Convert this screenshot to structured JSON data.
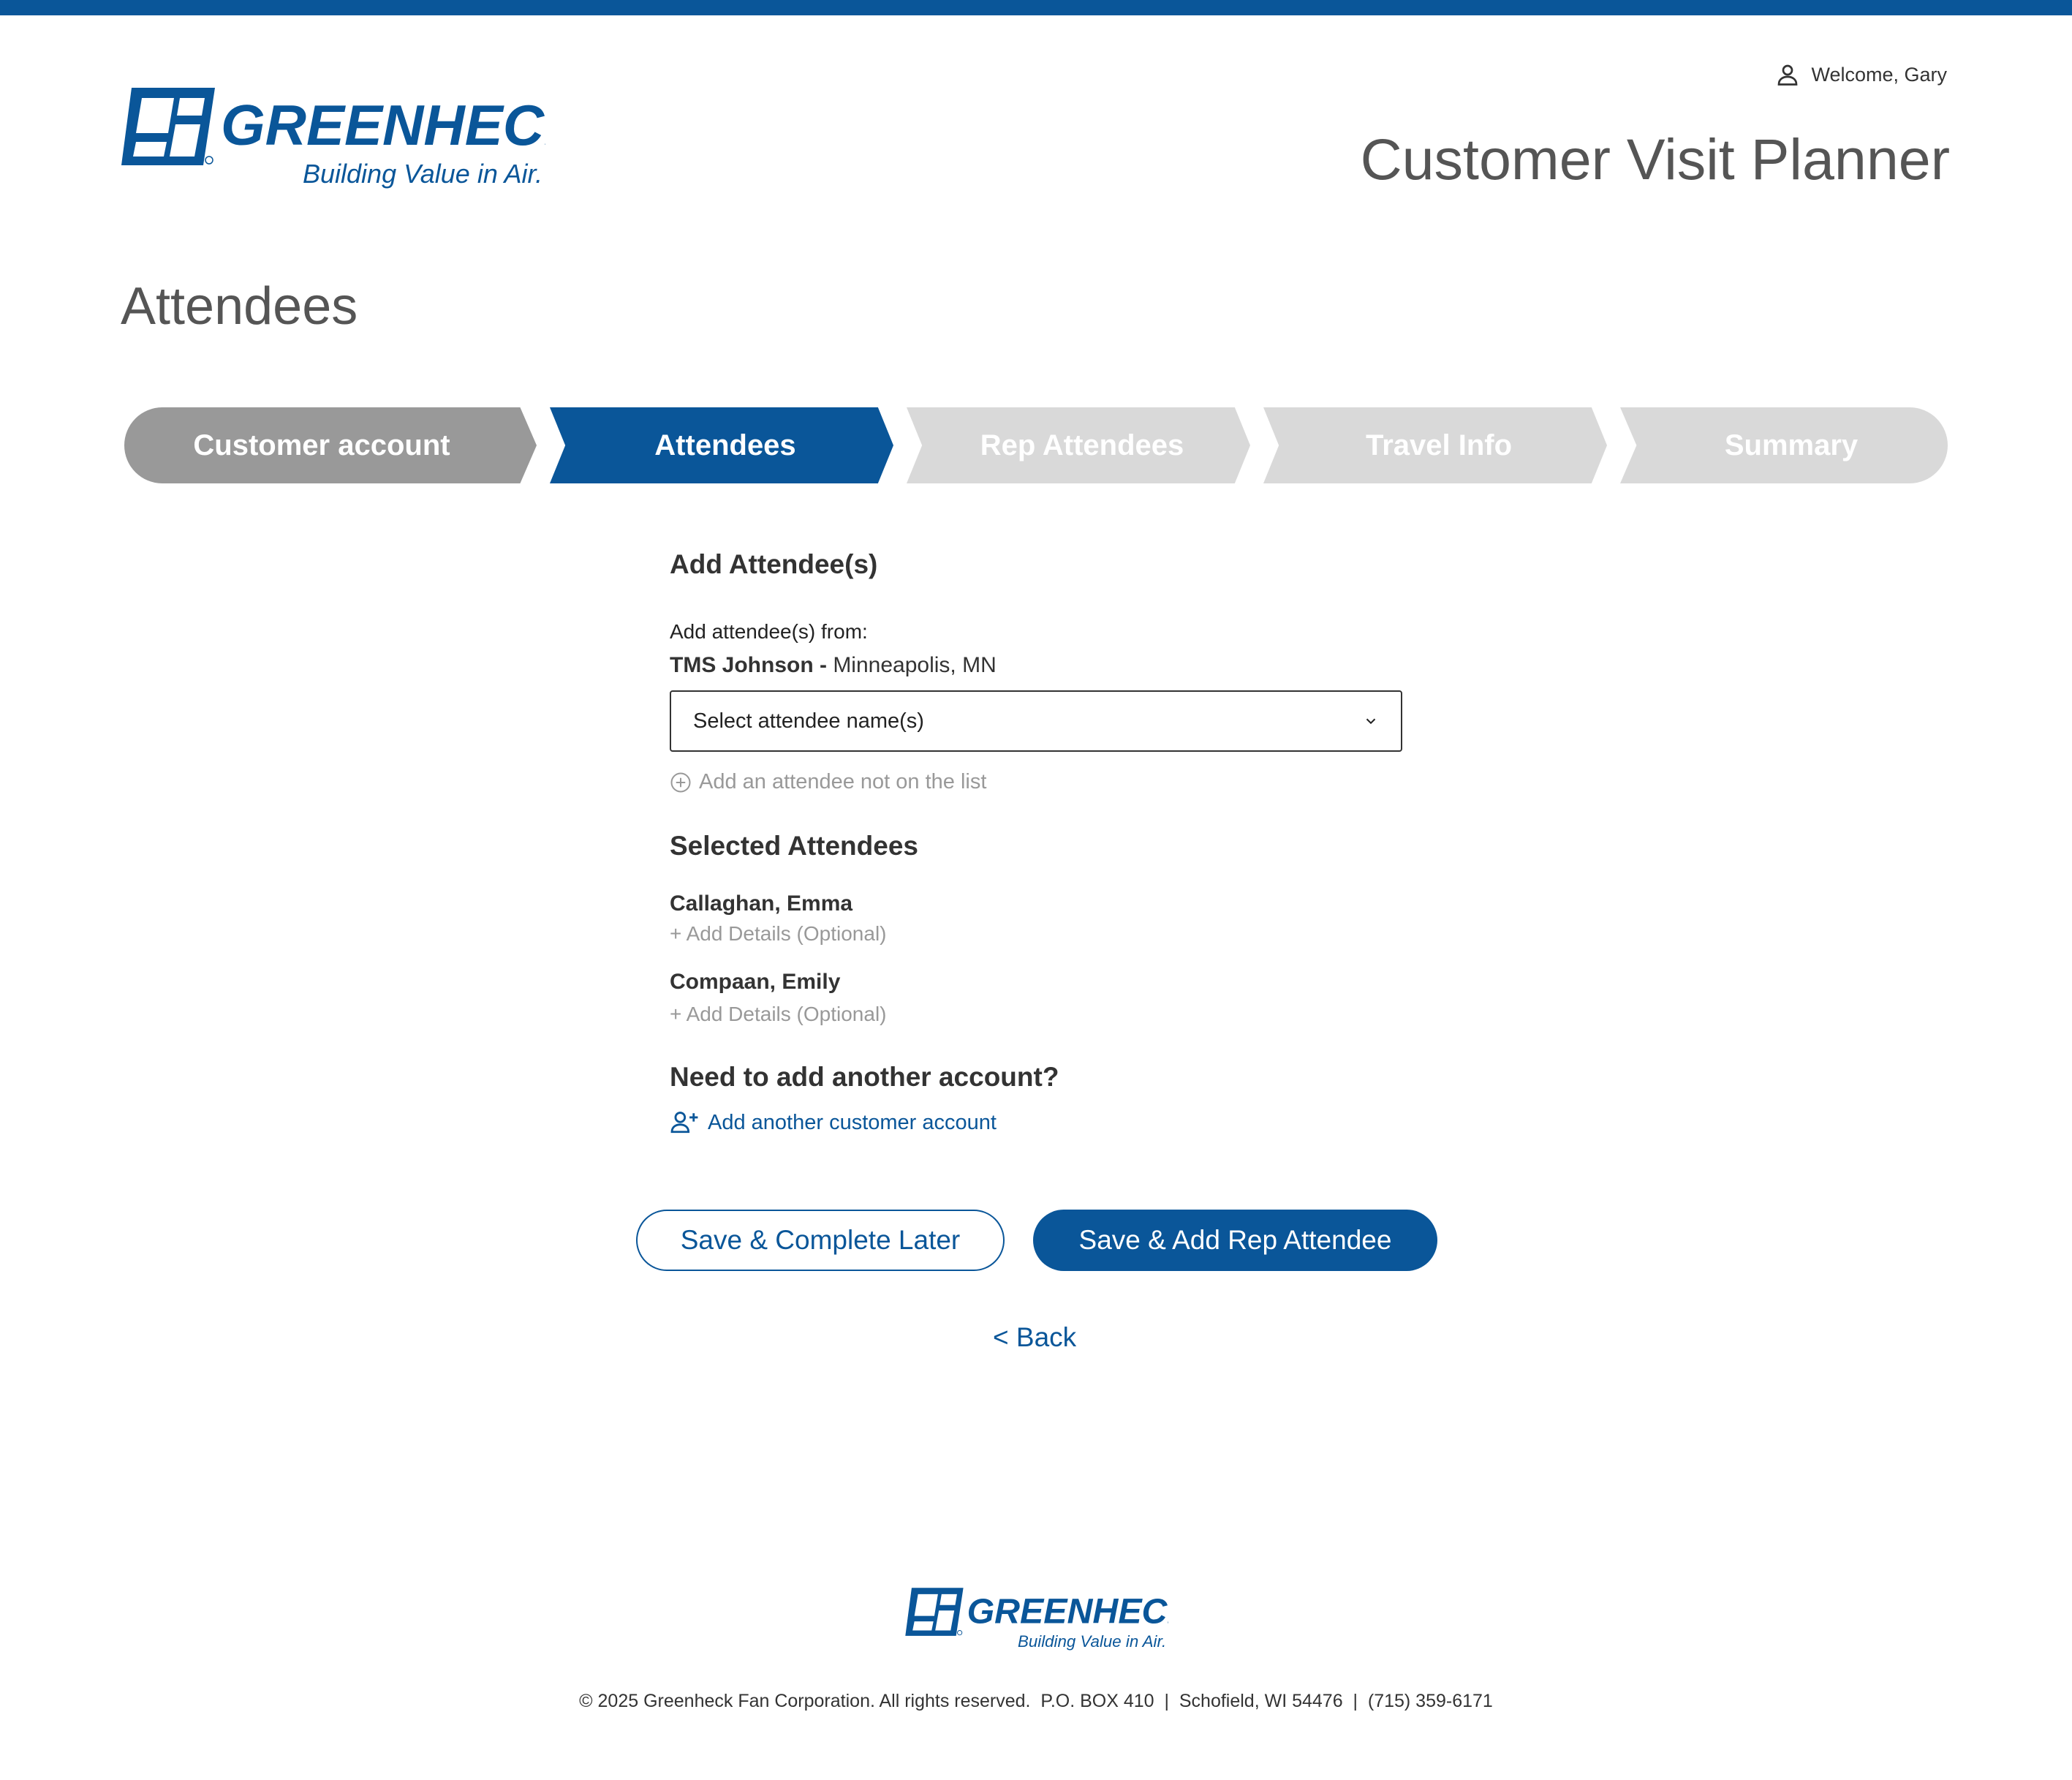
{
  "header": {
    "brand_name": "GREENHECK",
    "brand_tagline": "Building Value in Air.",
    "welcome": "Welcome, Gary",
    "app_title": "Customer Visit Planner"
  },
  "page": {
    "title": "Attendees"
  },
  "stepper": {
    "steps": [
      {
        "label": "Customer account",
        "state": "done"
      },
      {
        "label": "Attendees",
        "state": "active"
      },
      {
        "label": "Rep Attendees",
        "state": "todo"
      },
      {
        "label": "Travel Info",
        "state": "todo"
      },
      {
        "label": "Summary",
        "state": "todo"
      }
    ]
  },
  "form": {
    "heading": "Add Attendee(s)",
    "from_label": "Add attendee(s) from:",
    "source_account": "TMS Johnson -",
    "source_location": " Minneapolis, MN",
    "select_placeholder": "Select attendee name(s)",
    "add_not_on_list": "Add an attendee not on the list",
    "selected_heading": "Selected Attendees",
    "selected": [
      {
        "name": "Callaghan, Emma",
        "details_link": "+ Add Details (Optional)"
      },
      {
        "name": "Compaan, Emily",
        "details_link": "+ Add Details (Optional)"
      }
    ],
    "another_heading": "Need to add another account?",
    "add_another_account": "Add another customer account"
  },
  "actions": {
    "save_later": "Save & Complete Later",
    "save_next": "Save & Add Rep Attendee",
    "back": "< Back"
  },
  "footer": {
    "copyright": "© 2025 Greenheck Fan Corporation. All rights reserved.  P.O. BOX 410  |  Schofield, WI 54476  |  (715) 359-6171"
  },
  "colors": {
    "brand_blue": "#0a5699",
    "step_done": "#999999",
    "step_todo": "#d9d9d9",
    "muted_text": "#999999"
  }
}
